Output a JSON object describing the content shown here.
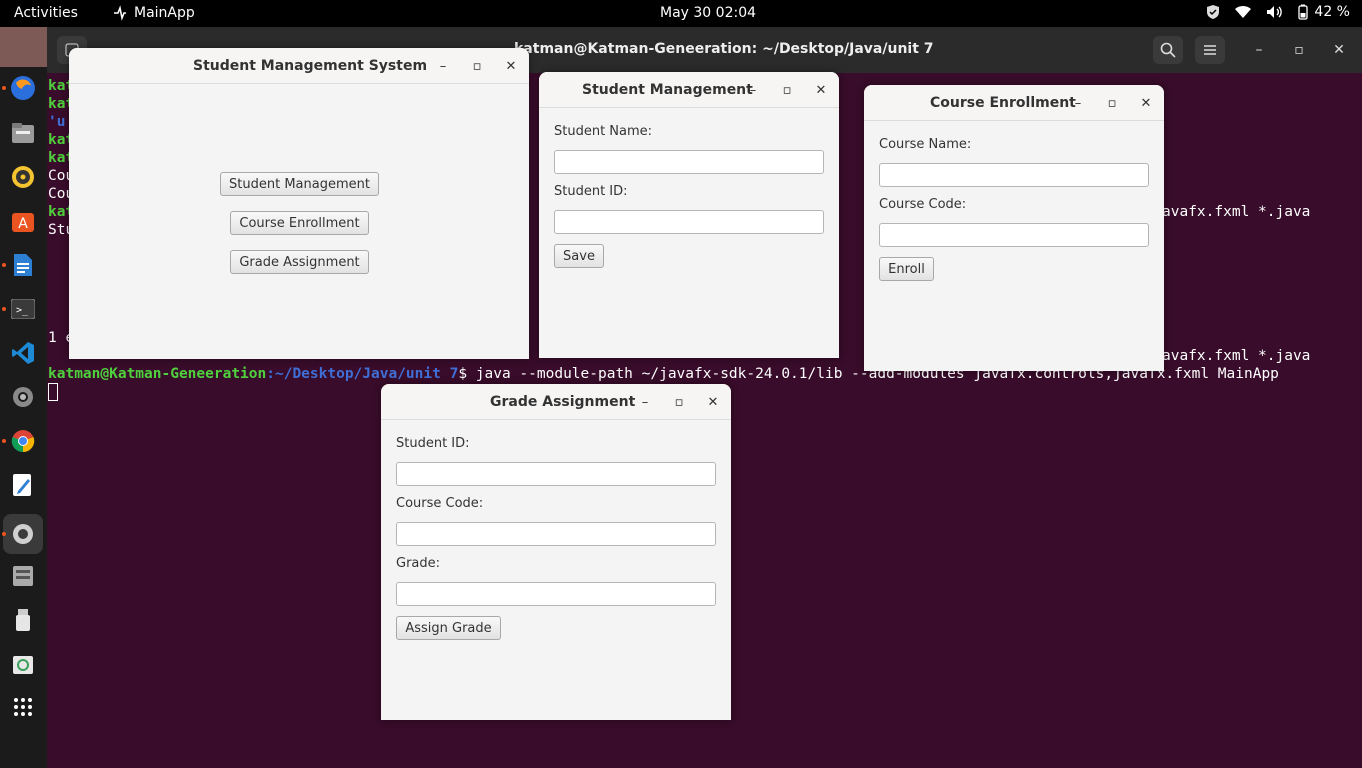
{
  "topbar": {
    "activities": "Activities",
    "app_name": "MainApp",
    "clock": "May 30  02:04",
    "battery": "42 %"
  },
  "dock": {
    "items": [
      "firefox-icon",
      "files-icon",
      "rhythmbox-icon",
      "software-icon",
      "writer-icon",
      "terminal-icon",
      "vscode-icon",
      "settings-icon",
      "chrome-icon",
      "text-editor-icon",
      "settings-active-icon",
      "server-icon",
      "usb-icon",
      "trash-icon",
      "apps-grid-icon"
    ]
  },
  "terminal": {
    "title": "katman@Katman-Geneeration: ~/Desktop/Java/unit 7",
    "lines": [
      {
        "prompt": "kat",
        "rest": ""
      },
      {
        "prompt": "kat",
        "rest": ""
      },
      {
        "prompt": "'u",
        "rest": ""
      },
      {
        "prompt": "kat",
        "rest": ""
      },
      {
        "prompt": "kat",
        "rest": ""
      },
      {
        "prompt": "",
        "rest": "Cou"
      },
      {
        "prompt": "",
        "rest": "Cou"
      },
      {
        "prompt": "kat",
        "rest": ""
      },
      {
        "prompt": "",
        "rest": "Stu"
      }
    ],
    "right_fragments": [
      "avafx.fxml *.java",
      "avafx.fxml *.java"
    ],
    "last_user": "katman@Katman-Geneeration",
    "last_path": ":~/Desktop/Java/unit 7",
    "last_cmd": "$ java --module-path ~/javafx-sdk-24.0.1/lib --add-modules javafx.controls,javafx.fxml MainApp",
    "err_line": "1 e"
  },
  "main_window": {
    "title": "Student Management System",
    "buttons": [
      "Student Management",
      "Course Enrollment",
      "Grade Assignment"
    ]
  },
  "student_window": {
    "title": "Student Management",
    "name_label": "Student Name:",
    "id_label": "Student ID:",
    "save": "Save"
  },
  "course_window": {
    "title": "Course Enrollment",
    "name_label": "Course Name:",
    "code_label": "Course Code:",
    "enroll": "Enroll"
  },
  "grade_window": {
    "title": "Grade Assignment",
    "id_label": "Student ID:",
    "code_label": "Course Code:",
    "grade_label": "Grade:",
    "assign": "Assign Grade"
  }
}
